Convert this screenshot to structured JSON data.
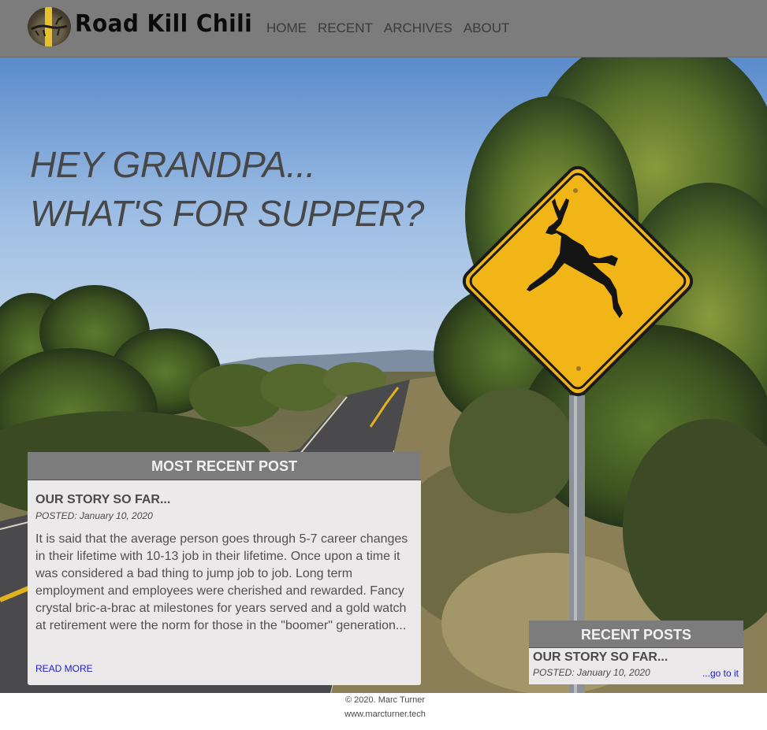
{
  "site": {
    "logo_text": "Road Kill Chili",
    "logo_image": "road-deer-logo-icon"
  },
  "nav": {
    "items": [
      "HOME",
      "RECENT",
      "ARCHIVES",
      "ABOUT"
    ]
  },
  "hero": {
    "headline_line1": "HEY GRANDPA...",
    "headline_line2": "WHAT'S FOR SUPPER?",
    "image": "deer-crossing-sign-photo"
  },
  "most_recent": {
    "heading": "MOST RECENT POST",
    "post_title": "OUR STORY SO FAR...",
    "posted": "POSTED: January 10, 2020",
    "excerpt": "It is said that the average person goes through 5-7 career changes in their lifetime with 10-13 job in their lifetime. Once upon a time it was considered a bad thing to jump job to job. Long term employment and employees were cherished and rewarded. Fancy crystal bric-a-brac at milestones for years served and a gold watch at retirement were the norm for those in the \"boomer\" generation...",
    "read_more": "READ MORE"
  },
  "recent_posts": {
    "heading": "RECENT POSTS",
    "items": [
      {
        "title": "OUR STORY SO FAR...",
        "posted": "POSTED: January 10, 2020",
        "link": "...go to it"
      }
    ]
  },
  "footer": {
    "copyright": "© 2020. Marc Turner",
    "site": "www.marcturner.tech"
  },
  "colors": {
    "header_bg": "#7c7c7c",
    "card_bg": "#ebe9ea",
    "link": "#2020c8",
    "sign_yellow": "#f2b517"
  }
}
